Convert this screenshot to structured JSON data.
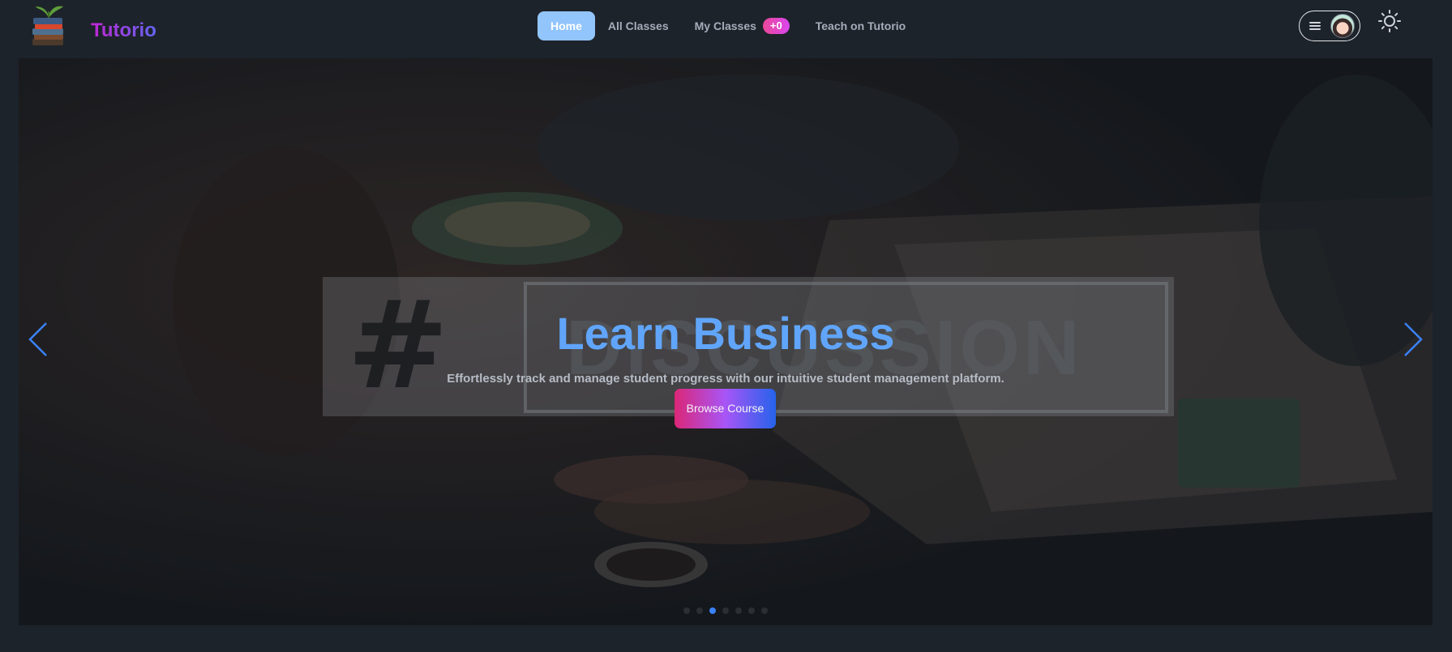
{
  "brand": {
    "name": "Tutorio",
    "logo_icon": "books-stack-plant-icon"
  },
  "nav": {
    "links": [
      {
        "label": "Home",
        "active": true
      },
      {
        "label": "All Classes",
        "active": false
      },
      {
        "label": "My Classes",
        "active": false,
        "badge": "+0"
      },
      {
        "label": "Teach on Tutorio",
        "active": false
      }
    ]
  },
  "user_menu": {
    "menu_icon": "hamburger-icon",
    "avatar_icon": "user-avatar"
  },
  "theme_toggle": {
    "icon": "sun-icon"
  },
  "hero": {
    "background_sign": {
      "hash": "#",
      "word": "DISCUSSION"
    },
    "title": "Learn Business",
    "subtitle": "Effortlessly track and manage student progress with our intuitive student management platform.",
    "cta_label": "Browse Course",
    "prev_icon": "chevron-left-icon",
    "next_icon": "chevron-right-icon",
    "slides_count": 7,
    "active_slide": 3
  },
  "colors": {
    "background": "#1d232a",
    "active_nav": "#93c5fd",
    "title": "#60a5fa",
    "arrow": "#3b82f6",
    "badge": "#ec4899",
    "cta_gradient": [
      "#db2777",
      "#a855f7",
      "#2563eb"
    ]
  }
}
